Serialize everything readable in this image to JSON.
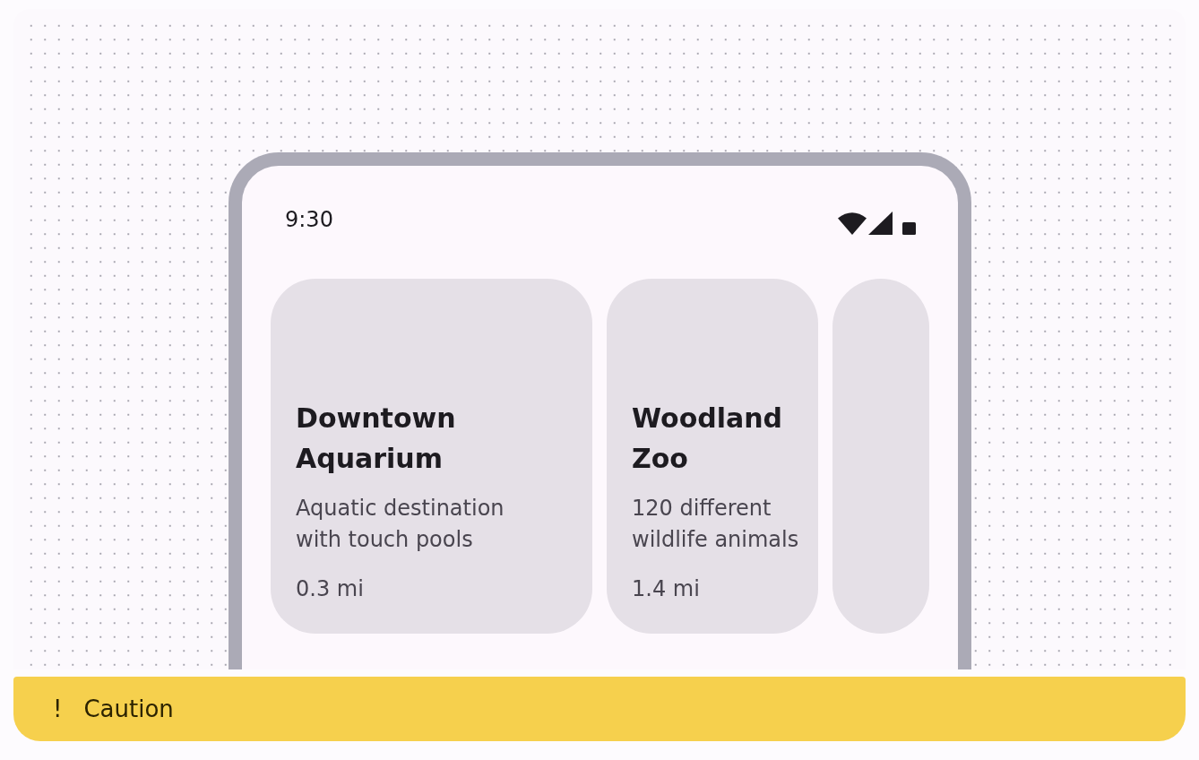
{
  "status_bar": {
    "time": "9:30"
  },
  "carousel": {
    "cards": [
      {
        "kind": "place",
        "title": "Downtown Aquarium",
        "description": "Aquatic destination with touch pools",
        "distance": "0.3 mi"
      },
      {
        "kind": "place",
        "title": "Woodland Zoo",
        "description": "120 different wildlife animals",
        "distance": "1.4 mi"
      },
      {
        "kind": "peek"
      }
    ]
  },
  "caution_banner": {
    "icon": "!",
    "label": "Caution"
  }
}
